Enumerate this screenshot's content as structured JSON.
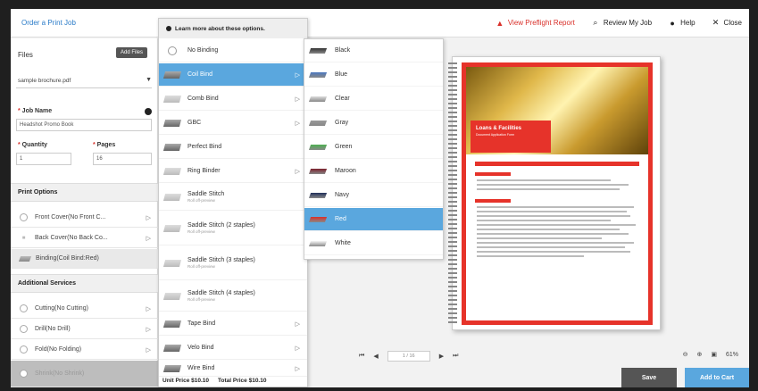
{
  "app": {
    "title": "Order a Print Job"
  },
  "topbar": {
    "preflight": "View Preflight Report",
    "review": "Review My Job",
    "help": "Help",
    "close": "Close"
  },
  "left": {
    "files_label": "Files",
    "add_files": "Add Files",
    "file_selected": "sample brochure.pdf",
    "job_name_label": "Job Name",
    "job_name_value": "Headshot Promo Book",
    "quantity_label": "Quantity",
    "quantity_value": "1",
    "pages_label": "Pages",
    "pages_value": "16",
    "print_options_title": "Print Options",
    "print_options": [
      {
        "label": "Front Cover(No Front C..."
      },
      {
        "label": "Back Cover(No Back Co..."
      },
      {
        "label": "Binding(Coil Bind:Red)"
      }
    ],
    "additional_title": "Additional Services",
    "additional": [
      {
        "label": "Cutting(No Cutting)"
      },
      {
        "label": "Drill(No Drill)"
      },
      {
        "label": "Fold(No Folding)"
      },
      {
        "label": "Shrink(No Shrink)"
      }
    ]
  },
  "binding": {
    "header": "Learn more about these options.",
    "items": [
      {
        "label": "No Binding",
        "sub": ""
      },
      {
        "label": "Coil Bind",
        "sub": ""
      },
      {
        "label": "Comb Bind",
        "sub": ""
      },
      {
        "label": "GBC",
        "sub": ""
      },
      {
        "label": "Perfect Bind",
        "sub": ""
      },
      {
        "label": "Ring Binder",
        "sub": ""
      },
      {
        "label": "Saddle Stitch",
        "sub": "Roll off-preview"
      },
      {
        "label": "Saddle Stitch (2 staples)",
        "sub": "Roll off-preview"
      },
      {
        "label": "Saddle Stitch (3 staples)",
        "sub": "Roll off-preview"
      },
      {
        "label": "Saddle Stitch (4 staples)",
        "sub": "Roll off-preview"
      },
      {
        "label": "Tape Bind",
        "sub": ""
      },
      {
        "label": "Velo Bind",
        "sub": ""
      },
      {
        "label": "Wire Bind",
        "sub": ""
      }
    ],
    "unit_price": "Unit Price $10.10",
    "total_price": "Total Price $10.10"
  },
  "colors": {
    "items": [
      {
        "label": "Black",
        "color": "#333333"
      },
      {
        "label": "Blue",
        "color": "#4a78c0"
      },
      {
        "label": "Clear",
        "color": "#dcdcdc"
      },
      {
        "label": "Gray",
        "color": "#999999"
      },
      {
        "label": "Green",
        "color": "#4caf50"
      },
      {
        "label": "Maroon",
        "color": "#7a1f2b"
      },
      {
        "label": "Navy",
        "color": "#1f2f5a"
      },
      {
        "label": "Red",
        "color": "#d9302a"
      },
      {
        "label": "White",
        "color": "#f5f5f5"
      }
    ]
  },
  "preview": {
    "doc_title": "Loans & Facilities",
    "doc_subtitle": "Document Application Form"
  },
  "pager": {
    "page": "1 / 16"
  },
  "zoom": {
    "level": "61%"
  },
  "footer": {
    "save": "Save",
    "add_to_cart": "Add to Cart"
  }
}
